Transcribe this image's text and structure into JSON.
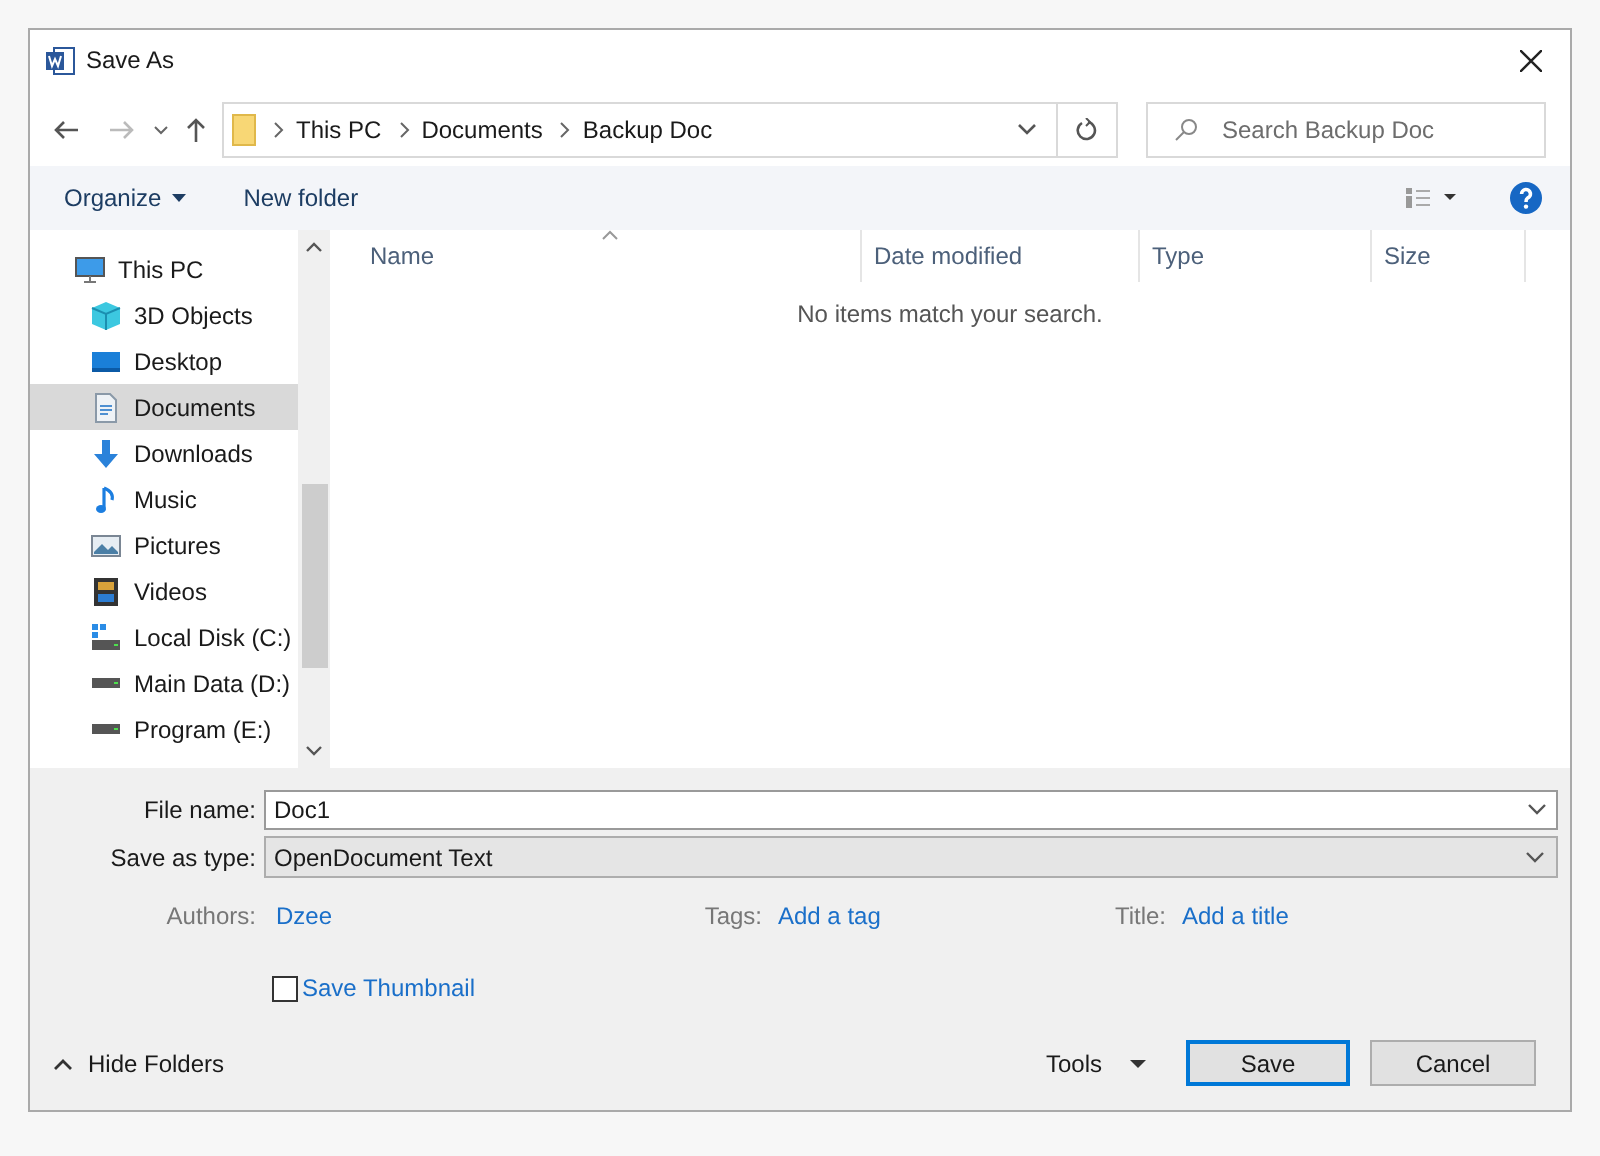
{
  "window": {
    "title": "Save As"
  },
  "address": {
    "crumbs": [
      "This PC",
      "Documents",
      "Backup Doc"
    ]
  },
  "search": {
    "placeholder": "Search Backup Doc"
  },
  "toolbar": {
    "organize": "Organize",
    "new_folder": "New folder"
  },
  "sidebar": {
    "items": [
      {
        "label": "This PC",
        "kind": "pc",
        "selected": false,
        "children": [
          {
            "label": "3D Objects",
            "kind": "cube",
            "selected": false
          },
          {
            "label": "Desktop",
            "kind": "desktop",
            "selected": false
          },
          {
            "label": "Documents",
            "kind": "documents",
            "selected": true
          },
          {
            "label": "Downloads",
            "kind": "downloads",
            "selected": false
          },
          {
            "label": "Music",
            "kind": "music",
            "selected": false
          },
          {
            "label": "Pictures",
            "kind": "pictures",
            "selected": false
          },
          {
            "label": "Videos",
            "kind": "videos",
            "selected": false
          },
          {
            "label": "Local Disk (C:)",
            "kind": "sysdrive",
            "selected": false
          },
          {
            "label": "Main Data (D:)",
            "kind": "drive",
            "selected": false
          },
          {
            "label": "Program (E:)",
            "kind": "drive",
            "selected": false
          }
        ]
      }
    ]
  },
  "table": {
    "columns": [
      "Name",
      "Date modified",
      "Type",
      "Size"
    ],
    "empty_message": "No items match your search."
  },
  "form": {
    "file_name_label": "File name:",
    "file_name": "Doc1",
    "type_label": "Save as type:",
    "type": "OpenDocument Text",
    "authors_label": "Authors:",
    "authors": "Dzee",
    "tags_label": "Tags:",
    "tags": "Add a tag",
    "title_label": "Title:",
    "title": "Add a title",
    "thumbnail": {
      "label": "Save Thumbnail",
      "checked": false
    }
  },
  "footer": {
    "hide_folders": "Hide Folders",
    "tools": "Tools",
    "save": "Save",
    "cancel": "Cancel"
  }
}
